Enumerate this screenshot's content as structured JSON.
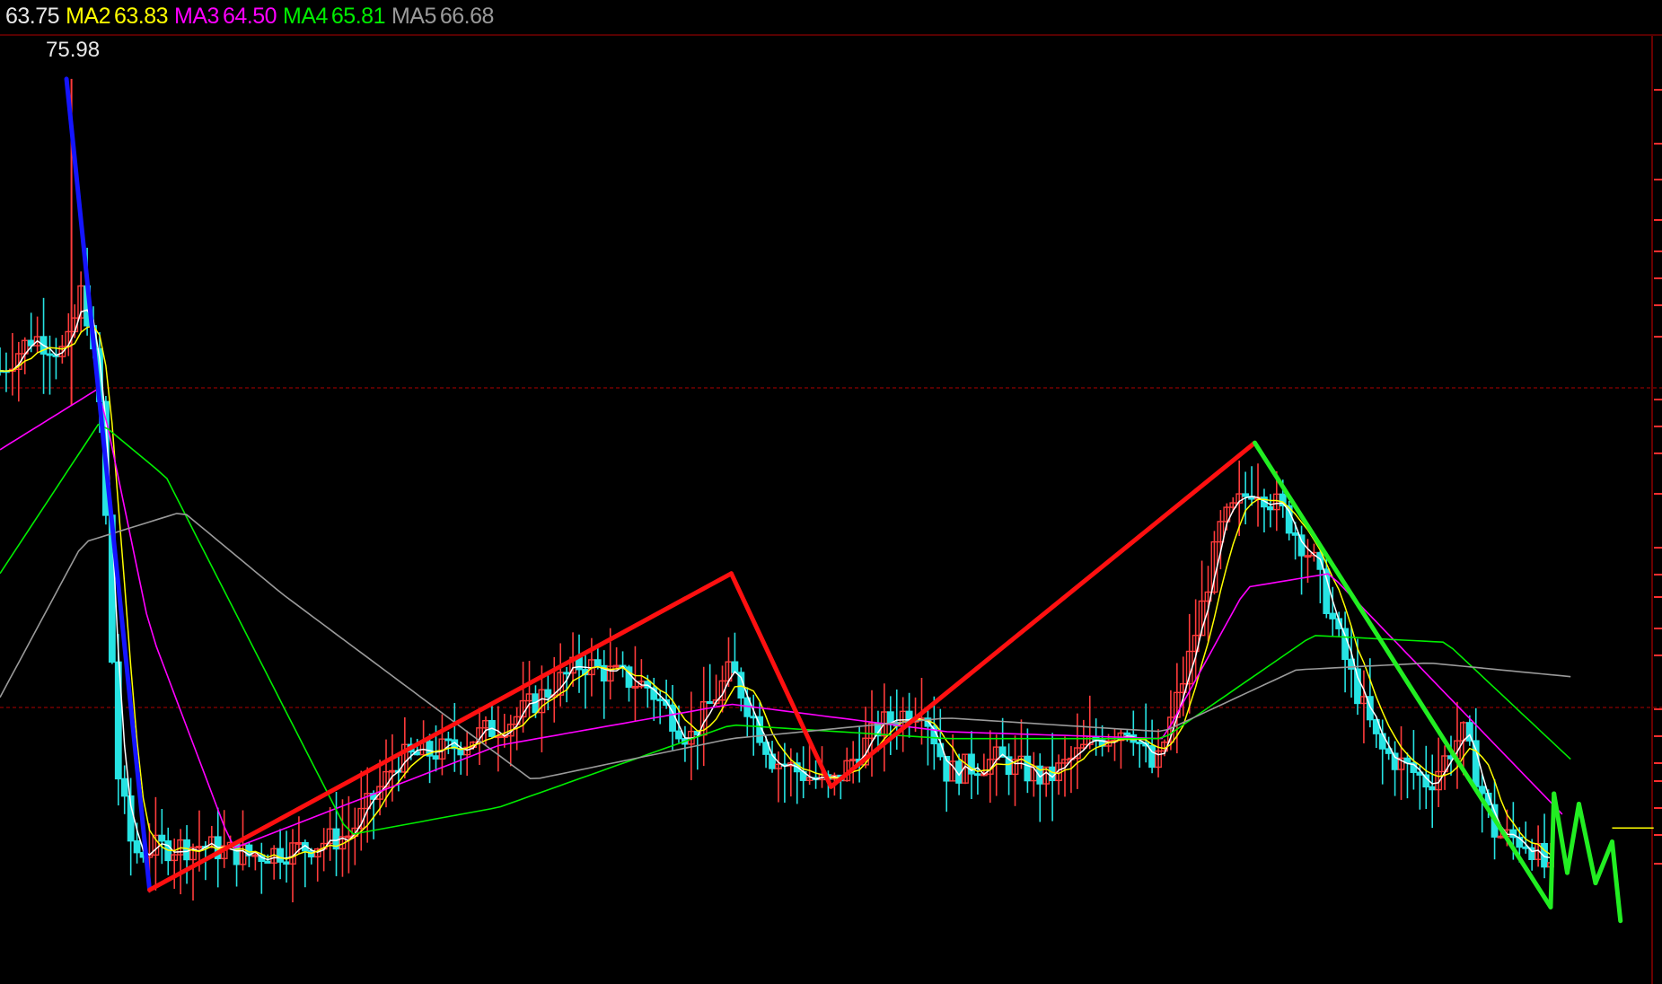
{
  "legend": {
    "ma1_value": "63.75",
    "ma2_label": "MA2",
    "ma2_value": "63.83",
    "ma3_label": "MA3",
    "ma3_value": "64.50",
    "ma4_label": "MA4",
    "ma4_value": "65.81",
    "ma5_label": "MA5",
    "ma5_value": "66.68"
  },
  "high_label": "75.98",
  "colors": {
    "background": "#000000",
    "up_candle": "#ff3b3b",
    "down_candle": "#26e3e3",
    "ma1": "#ffffff",
    "ma2": "#ffff00",
    "ma3": "#ff00ff",
    "ma4": "#00ee00",
    "ma5": "#9a9a9a",
    "grid": "#8b0000",
    "trend_up": "#ff1010",
    "trend_down_start": "#1515ff",
    "trend_down_end": "#22ee22"
  },
  "chart_data": {
    "type": "candlestick",
    "price_range": [
      50.5,
      76.5
    ],
    "high_marker": 75.98,
    "grid": "horizontal dashed",
    "series": [
      {
        "name": "MA2",
        "value": 63.83
      },
      {
        "name": "MA3",
        "value": 64.5
      },
      {
        "name": "MA4",
        "value": 65.81
      },
      {
        "name": "MA5",
        "value": 66.68
      }
    ],
    "trend_waypoints": [
      {
        "t": 0.04,
        "p": 75.98,
        "color": "blue"
      },
      {
        "t": 0.09,
        "p": 52.4,
        "color": "red"
      },
      {
        "t": 0.44,
        "p": 61.6,
        "color": "red"
      },
      {
        "t": 0.5,
        "p": 55.4,
        "color": "red"
      },
      {
        "t": 0.755,
        "p": 65.4,
        "color": "green"
      },
      {
        "t": 0.933,
        "p": 51.9,
        "color": "green"
      },
      {
        "t": 0.935,
        "p": 55.2,
        "color": "green"
      },
      {
        "t": 0.943,
        "p": 52.9,
        "color": "green"
      },
      {
        "t": 0.95,
        "p": 54.9,
        "color": "green"
      },
      {
        "t": 0.96,
        "p": 52.6,
        "color": "green"
      },
      {
        "t": 0.97,
        "p": 53.8,
        "color": "green"
      },
      {
        "t": 0.975,
        "p": 51.5,
        "color": "green"
      }
    ],
    "price_path": [
      [
        0.0,
        67.5
      ],
      [
        0.02,
        68.5
      ],
      [
        0.04,
        68.0
      ],
      [
        0.05,
        70.0
      ],
      [
        0.06,
        66.5
      ],
      [
        0.065,
        62.0
      ],
      [
        0.07,
        56.0
      ],
      [
        0.08,
        53.5
      ],
      [
        0.09,
        53.6
      ],
      [
        0.12,
        53.7
      ],
      [
        0.15,
        53.4
      ],
      [
        0.18,
        53.6
      ],
      [
        0.21,
        54.0
      ],
      [
        0.24,
        56.2
      ],
      [
        0.27,
        56.5
      ],
      [
        0.31,
        57.4
      ],
      [
        0.35,
        59.0
      ],
      [
        0.39,
        58.3
      ],
      [
        0.415,
        56.8
      ],
      [
        0.44,
        58.8
      ],
      [
        0.465,
        56.2
      ],
      [
        0.5,
        55.4
      ],
      [
        0.53,
        57.2
      ],
      [
        0.555,
        57.8
      ],
      [
        0.57,
        55.8
      ],
      [
        0.6,
        56.2
      ],
      [
        0.63,
        55.6
      ],
      [
        0.66,
        56.8
      ],
      [
        0.68,
        57.2
      ],
      [
        0.695,
        55.8
      ],
      [
        0.715,
        59.0
      ],
      [
        0.735,
        63.0
      ],
      [
        0.755,
        64.2
      ],
      [
        0.77,
        63.5
      ],
      [
        0.79,
        62.0
      ],
      [
        0.81,
        59.0
      ],
      [
        0.83,
        56.5
      ],
      [
        0.86,
        55.5
      ],
      [
        0.88,
        57.0
      ],
      [
        0.9,
        54.0
      ],
      [
        0.92,
        53.8
      ],
      [
        0.933,
        52.8
      ]
    ],
    "ma_reference_points": {
      "MA3": [
        [
          0.0,
          65.2
        ],
        [
          0.06,
          67.0
        ],
        [
          0.09,
          60.0
        ],
        [
          0.14,
          53.6
        ],
        [
          0.3,
          56.6
        ],
        [
          0.44,
          57.8
        ],
        [
          0.57,
          57.0
        ],
        [
          0.7,
          56.8
        ],
        [
          0.75,
          61.2
        ],
        [
          0.8,
          61.6
        ],
        [
          0.94,
          54.6
        ]
      ],
      "MA4": [
        [
          0.0,
          61.6
        ],
        [
          0.06,
          66.0
        ],
        [
          0.1,
          64.4
        ],
        [
          0.21,
          54.0
        ],
        [
          0.3,
          54.8
        ],
        [
          0.44,
          57.2
        ],
        [
          0.57,
          56.8
        ],
        [
          0.7,
          56.8
        ],
        [
          0.79,
          59.8
        ],
        [
          0.87,
          59.6
        ],
        [
          0.945,
          56.2
        ]
      ],
      "MA5": [
        [
          0.0,
          58.0
        ],
        [
          0.05,
          62.5
        ],
        [
          0.11,
          63.4
        ],
        [
          0.17,
          61.0
        ],
        [
          0.32,
          55.6
        ],
        [
          0.44,
          56.8
        ],
        [
          0.57,
          57.4
        ],
        [
          0.7,
          57.0
        ],
        [
          0.78,
          58.8
        ],
        [
          0.86,
          59.0
        ],
        [
          0.945,
          58.6
        ]
      ]
    }
  }
}
